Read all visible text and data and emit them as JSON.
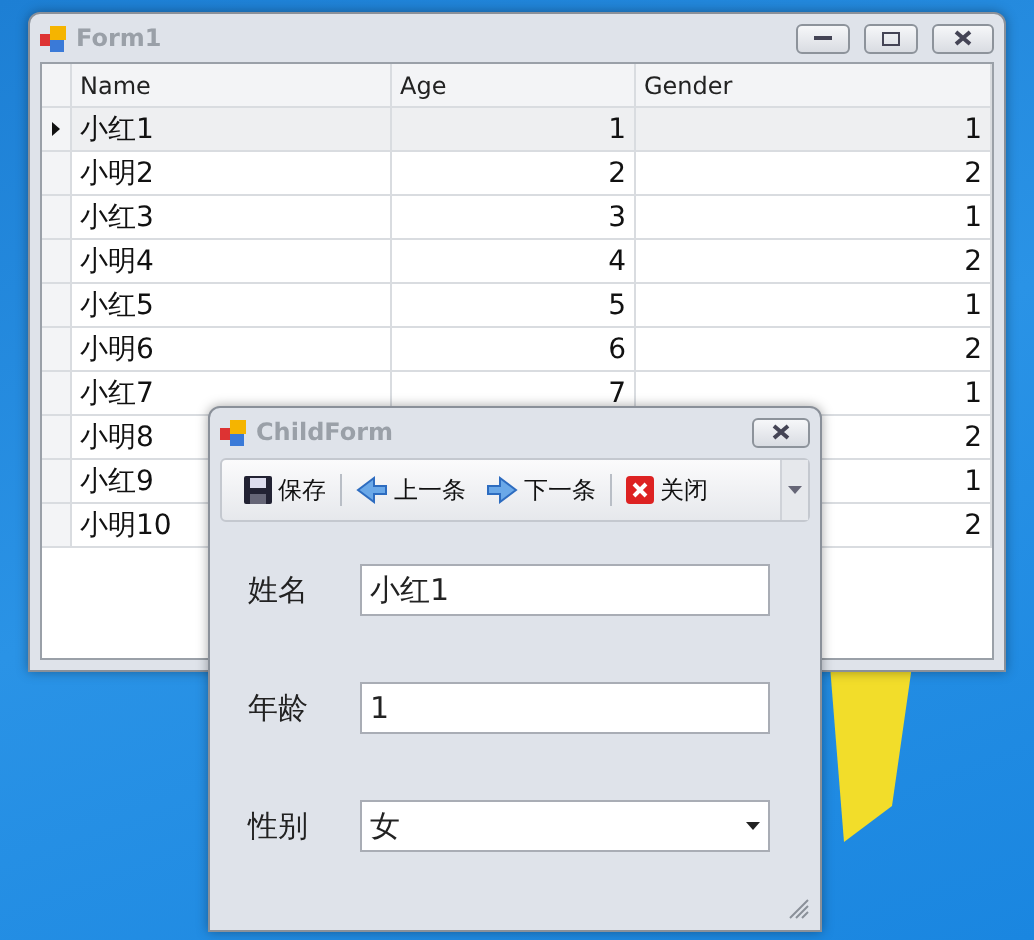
{
  "main_window": {
    "title": "Form1",
    "grid": {
      "columns": [
        "Name",
        "Age",
        "Gender"
      ],
      "rows": [
        {
          "name": "小红1",
          "age": "1",
          "gender": "1",
          "selected": true
        },
        {
          "name": "小明2",
          "age": "2",
          "gender": "2",
          "selected": false
        },
        {
          "name": "小红3",
          "age": "3",
          "gender": "1",
          "selected": false
        },
        {
          "name": "小明4",
          "age": "4",
          "gender": "2",
          "selected": false
        },
        {
          "name": "小红5",
          "age": "5",
          "gender": "1",
          "selected": false
        },
        {
          "name": "小明6",
          "age": "6",
          "gender": "2",
          "selected": false
        },
        {
          "name": "小红7",
          "age": "7",
          "gender": "1",
          "selected": false
        },
        {
          "name": "小明8",
          "gender": "2",
          "selected": false
        },
        {
          "name": "小红9",
          "gender": "1",
          "selected": false
        },
        {
          "name": "小明10",
          "gender": "2",
          "selected": false
        }
      ]
    }
  },
  "child_window": {
    "title": "ChildForm",
    "toolbar": [
      {
        "kind": "save",
        "label": "保存"
      },
      {
        "kind": "prev",
        "label": "上一条"
      },
      {
        "kind": "next",
        "label": "下一条"
      },
      {
        "kind": "close",
        "label": "关闭"
      }
    ],
    "fields": [
      {
        "kind": "text",
        "label": "姓名",
        "value": "小红1"
      },
      {
        "kind": "text",
        "label": "年龄",
        "value": "1"
      },
      {
        "kind": "combo",
        "label": "性别",
        "value": "女"
      }
    ]
  }
}
